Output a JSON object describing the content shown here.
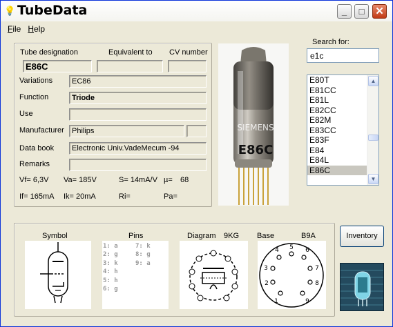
{
  "app": {
    "title": "TubeData",
    "icon": "lightbulb-icon"
  },
  "menu": {
    "file": "File",
    "file_key": "F",
    "file_rest": "ile",
    "help": "Help",
    "help_key": "H",
    "help_rest": "elp"
  },
  "search": {
    "label": "Search for:",
    "value": "e1c"
  },
  "tube": {
    "designation_label": "Tube designation",
    "equivalent_label": "Equivalent to",
    "cv_label": "CV number",
    "designation": "E86C",
    "equivalent": "",
    "cv": "",
    "variations_label": "Variations",
    "variations": "EC86",
    "function_label": "Function",
    "function": "Triode",
    "use_label": "Use",
    "use": "",
    "manufacturer_label": "Manufacturer",
    "manufacturer": "Philips",
    "databook_label": "Data book",
    "databook": "Electronic Univ.VadeMecum -94",
    "remarks_label": "Remarks",
    "remarks": ""
  },
  "params": {
    "vf": "Vf= 6,3V",
    "va": "Va= 185V",
    "s": "S= 14mA/V",
    "mu_label": "µ=",
    "mu": "68",
    "if": "If= 165mA",
    "ik": "Ik= 20mA",
    "ri": "Ri=",
    "pa": "Pa="
  },
  "photo": {
    "tube_label": "E86C",
    "brand": "SIEMENS"
  },
  "tube_list": {
    "items": [
      "E80T",
      "E81CC",
      "E81L",
      "E82CC",
      "E82M",
      "E83CC",
      "E83F",
      "E84",
      "E84L",
      "E86C"
    ],
    "selected": "E86C"
  },
  "lower": {
    "symbol_label": "Symbol",
    "pins_label": "Pins",
    "diagram_label": "Diagram",
    "diagram_code": "9KG",
    "base_label": "Base",
    "base_code": "B9A",
    "pins_col1": [
      "1: a",
      "2: g",
      "3: k",
      "4: h",
      "5: h",
      "6: g"
    ],
    "pins_col2": [
      "7: k",
      "8: g",
      "9: a"
    ]
  },
  "buttons": {
    "inventory": "Inventory",
    "close": "✕",
    "minimize": "_",
    "maximize": "□"
  }
}
